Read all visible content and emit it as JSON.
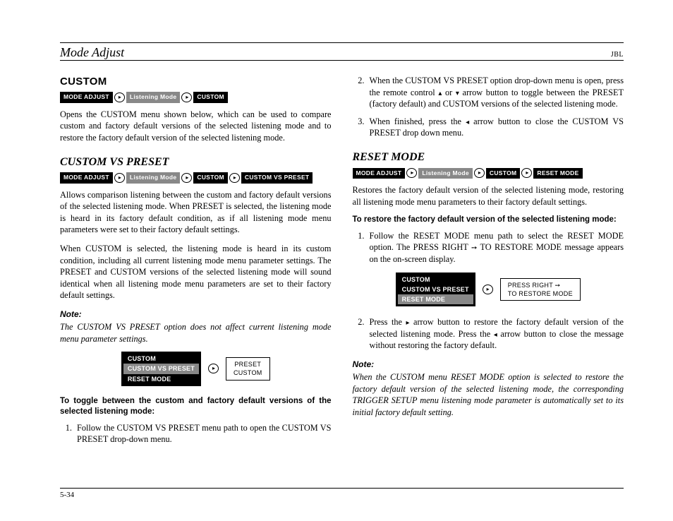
{
  "header": {
    "left": "Mode Adjust",
    "right": "JBL"
  },
  "page_number": "5-34",
  "col1": {
    "h_custom": "CUSTOM",
    "chips1": {
      "a": "MODE ADJUST",
      "b": "Listening Mode",
      "c": "CUSTOM"
    },
    "p_custom": "Opens the CUSTOM menu shown below, which can be used to compare custom and factory default versions of the selected listening mode and to restore the factory default version of the selected listening mode.",
    "h_cvp": "CUSTOM VS PRESET",
    "chips2": {
      "a": "MODE ADJUST",
      "b": "Listening Mode",
      "c": "CUSTOM",
      "d": "CUSTOM VS PRESET"
    },
    "p_cvp1": "Allows comparison listening between the custom and factory default versions of the selected listening mode. When PRESET is selected, the listening mode is heard in its factory default condition, as if all listening mode menu parameters were set to their factory default settings.",
    "p_cvp2": "When CUSTOM is selected, the listening mode is heard in its custom condition, including all current listening mode menu parameter settings. The PRESET and CUSTOM versions of the selected listening mode will sound identical when all listening mode menu parameters are set to their factory default settings.",
    "note_label": "Note:",
    "note_body": "The CUSTOM VS PRESET option does not affect current listening mode menu parameter settings.",
    "osd": {
      "r1": "CUSTOM",
      "r2": "CUSTOM VS PRESET",
      "r3": "RESET MODE",
      "box_l1": "PRESET",
      "box_l2": "CUSTOM"
    },
    "bold": "To toggle between the custom and factory default versions of the selected listening mode:",
    "step1": "Follow the CUSTOM VS PRESET menu path to open the CUSTOM VS PRESET drop-down menu."
  },
  "col2": {
    "step2a": "When the CUSTOM VS PRESET option drop-down menu is open, press the remote control ",
    "step2b": " or ",
    "step2c": " arrow button to toggle between the PRESET (factory default) and CUSTOM versions of the selected listening mode.",
    "step3a": "When finished, press the ",
    "step3b": " arrow button to close the CUSTOM VS PRESET drop down menu.",
    "h_reset": "RESET MODE",
    "chips": {
      "a": "MODE ADJUST",
      "b": "Listening Mode",
      "c": "CUSTOM",
      "d": "RESET MODE"
    },
    "p_reset": "Restores the factory default version of the selected listening mode, restoring all listening mode menu parameters to their factory default settings.",
    "bold": "To restore the factory default version of the selected listening mode:",
    "rstep1a": "Follow the RESET MODE menu path to select the RESET MODE option. The PRESS RIGHT ",
    "rstep1b": " TO RESTORE MODE message appears on the on-screen display.",
    "osd": {
      "r1": "CUSTOM",
      "r2": "CUSTOM VS PRESET",
      "r3": "RESET MODE",
      "box_l1": "PRESS RIGHT  ➙",
      "box_l2": "TO RESTORE MODE"
    },
    "rstep2a": "Press the ",
    "rstep2b": " arrow button to restore the factory default version of the selected listening mode. Press the ",
    "rstep2c": " arrow button to close the message without restoring the factory default.",
    "note_label": "Note:",
    "note_body": "When the CUSTOM menu RESET MODE option is selected to restore the factory default version of the selected listening mode, the corresponding TRIGGER SETUP menu listening mode parameter is automatically set to its initial factory default setting."
  },
  "glyph": {
    "up": "▴",
    "down": "▾",
    "left": "◂",
    "right": "▸",
    "rarr": "➙",
    "circ": "▸"
  }
}
